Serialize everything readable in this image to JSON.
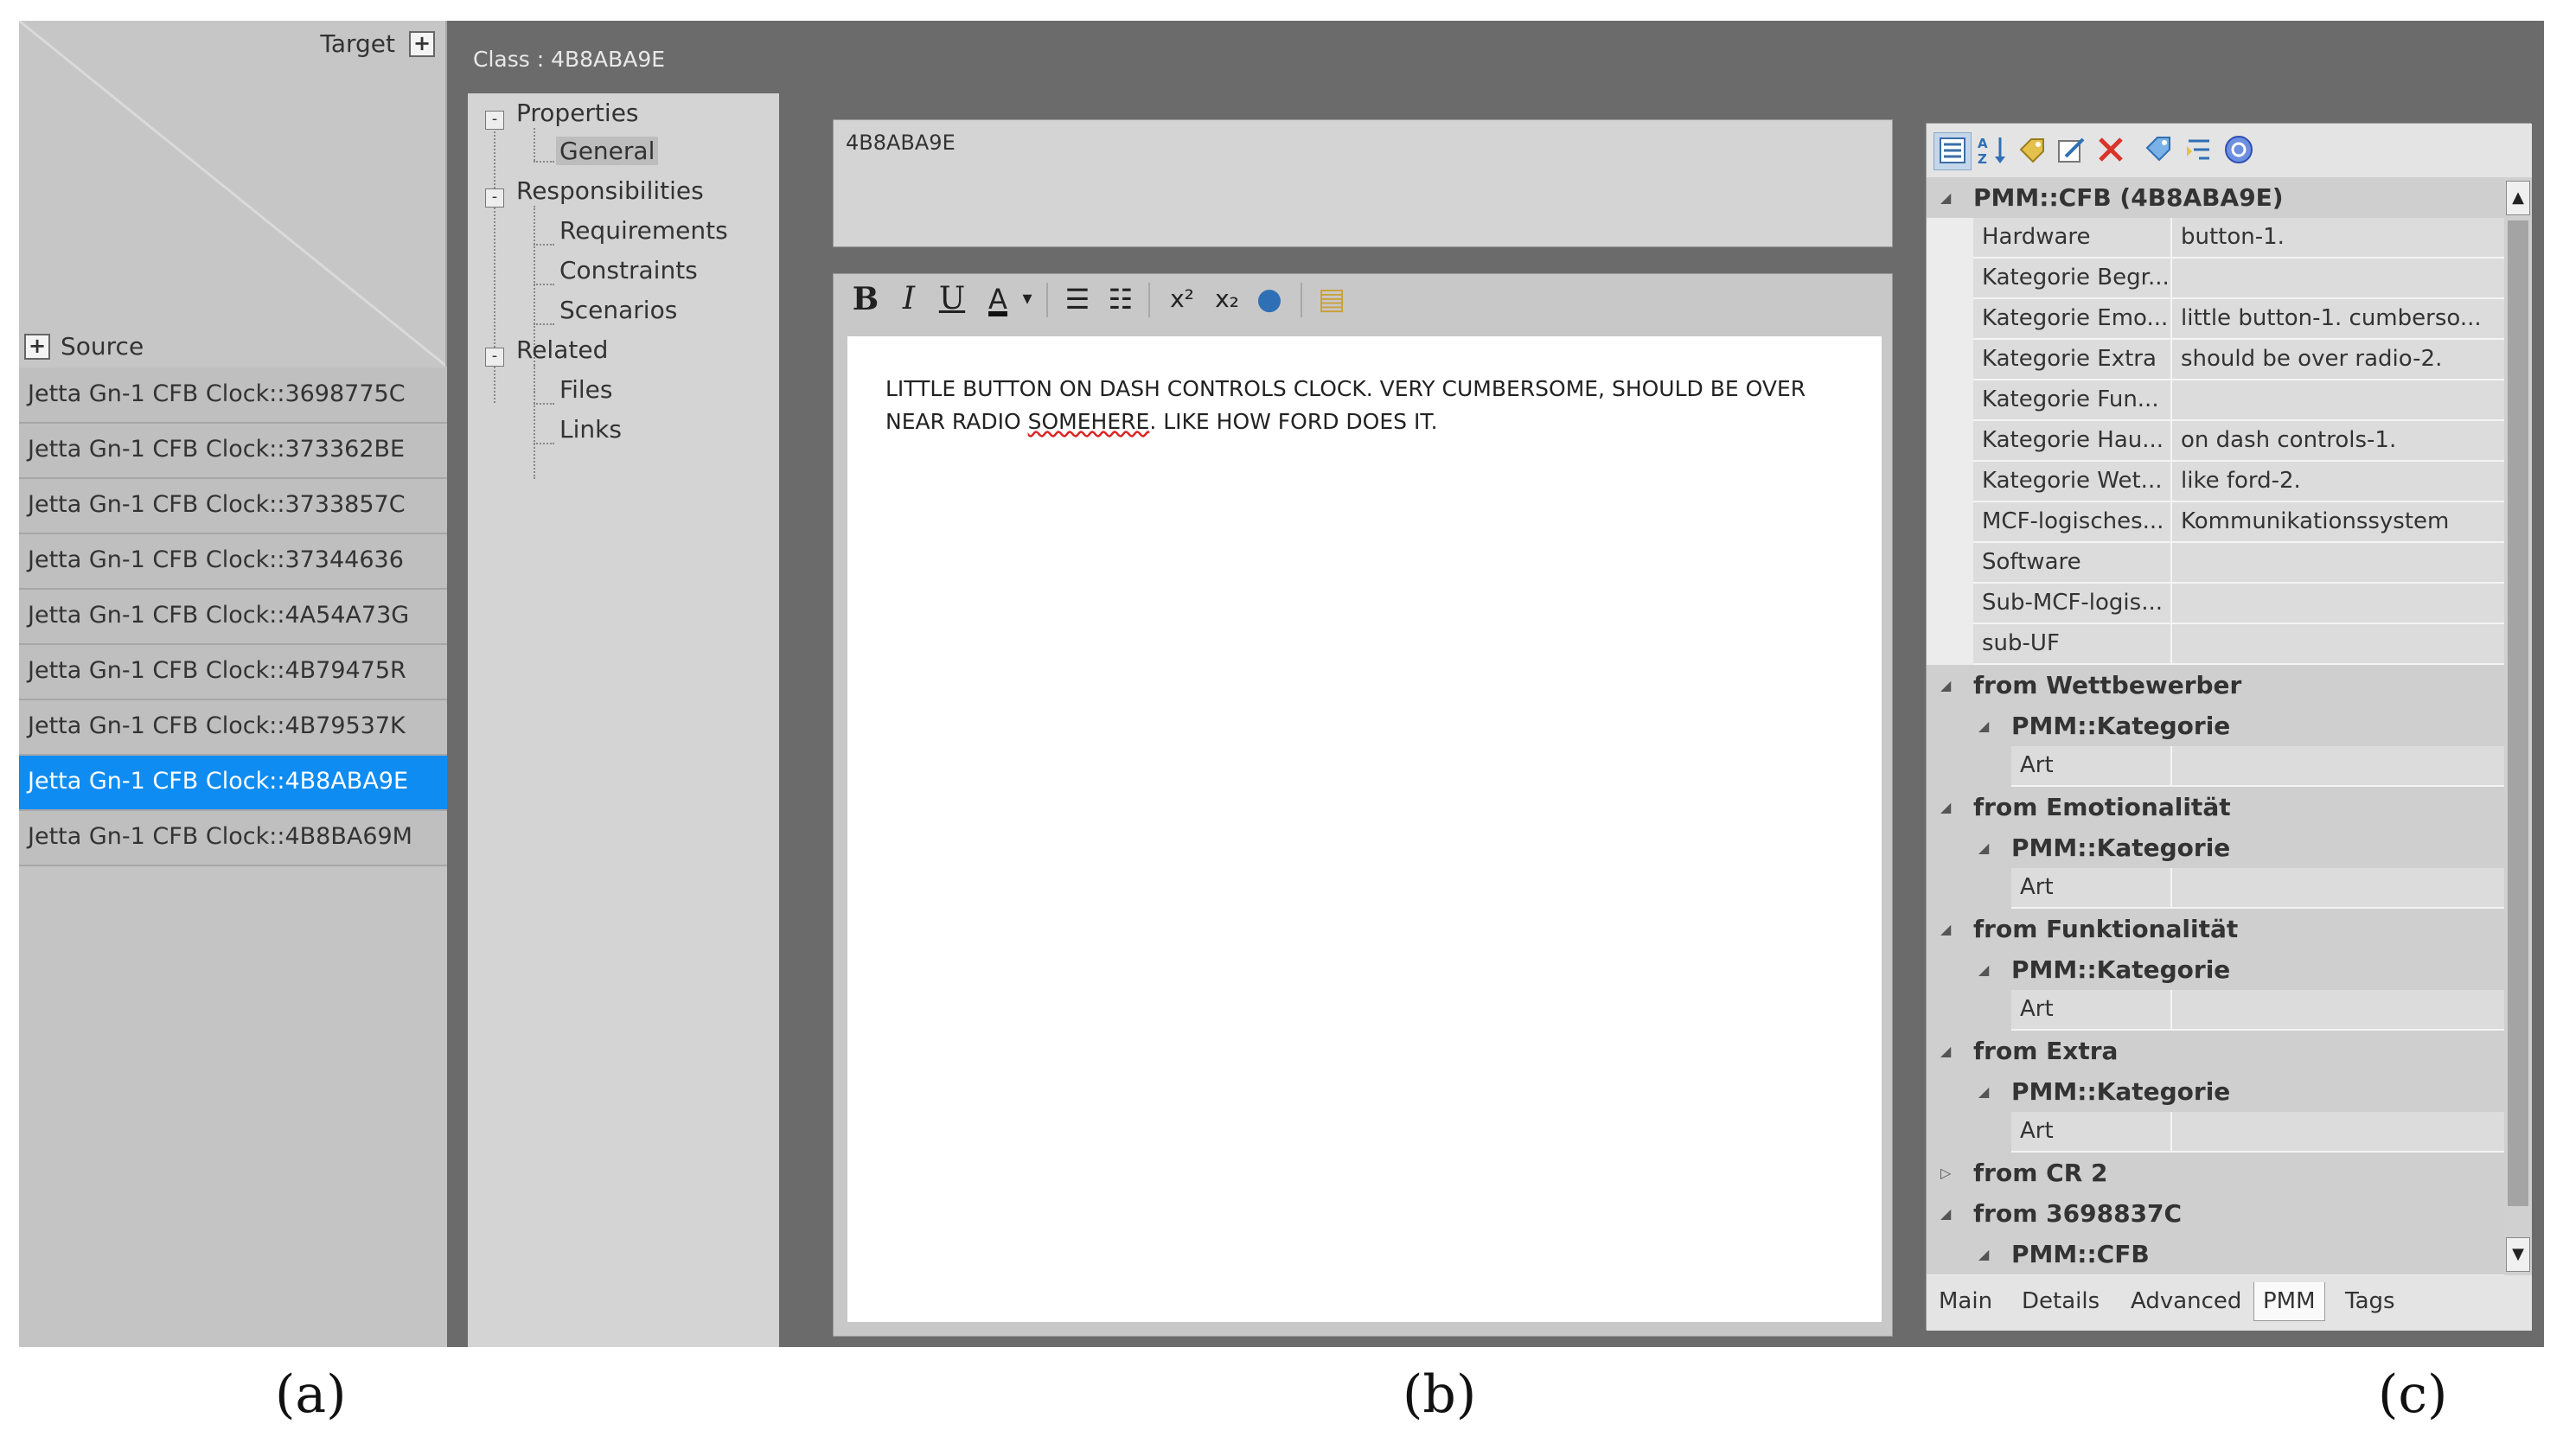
{
  "panel_a": {
    "target_label": "Target",
    "target_btn": "+",
    "source_btn": "+",
    "source_label": "Source",
    "rows": [
      "Jetta Gn-1 CFB Clock::3698775C",
      "Jetta Gn-1 CFB Clock::373362BE",
      "Jetta Gn-1 CFB Clock::3733857C",
      "Jetta Gn-1 CFB Clock::37344636",
      "Jetta Gn-1 CFB Clock::4A54A73G",
      "Jetta Gn-1 CFB Clock::4B79475R",
      "Jetta Gn-1 CFB Clock::4B79537K",
      "Jetta Gn-1 CFB Clock::4B8ABA9E",
      "Jetta Gn-1 CFB Clock::4B8BA69M"
    ],
    "selected_index": 7
  },
  "panel_b": {
    "class_title": "Class : 4B8ABA9E",
    "tree": {
      "properties": "Properties",
      "general": "General",
      "responsibilities": "Responsibilities",
      "requirements": "Requirements",
      "constraints": "Constraints",
      "scenarios": "Scenarios",
      "related": "Related",
      "files": "Files",
      "links": "Links",
      "toggle": "-"
    },
    "name_value": "4B8ABA9E",
    "toolbar": {
      "bold": "B",
      "italic": "I",
      "underline": "U",
      "color": "A",
      "dropdown": "▾",
      "bullets": "☰",
      "numbers": "☷",
      "superscript": "x²",
      "subscript": "x₂",
      "web": "●",
      "doc": "▤"
    },
    "text_line1": "LITTLE BUTTON ON DASH CONTROLS CLOCK. VERY CUMBERSOME, SHOULD BE OVER",
    "text_line2_a": "NEAR RADIO ",
    "text_line2_misspelled": "SOMEHERE",
    "text_line2_b": ". LIKE HOW FORD DOES IT."
  },
  "panel_c": {
    "icons": [
      "categorized-icon",
      "sort-az-icon",
      "tag-add-icon",
      "edit-icon",
      "delete-icon",
      "tag-icon",
      "filter-icon",
      "help-icon"
    ],
    "caret_open": "◢",
    "caret_closed": "▷",
    "root": "PMM::CFB (4B8ABA9E)",
    "props": [
      {
        "name": "Hardware",
        "value": "button-1."
      },
      {
        "name": "Kategorie Begr...",
        "value": ""
      },
      {
        "name": "Kategorie Emo...",
        "value": "little button-1. cumberso..."
      },
      {
        "name": "Kategorie Extra",
        "value": "should be over radio-2."
      },
      {
        "name": "Kategorie Fun...",
        "value": ""
      },
      {
        "name": "Kategorie Hau...",
        "value": "on dash controls-1."
      },
      {
        "name": "Kategorie Wet...",
        "value": "like ford-2."
      },
      {
        "name": "MCF-logisches...",
        "value": "Kommunikationssystem"
      },
      {
        "name": "Software",
        "value": ""
      },
      {
        "name": "Sub-MCF-logis...",
        "value": ""
      },
      {
        "name": "sub-UF",
        "value": ""
      }
    ],
    "groups": [
      {
        "label": "from Wettbewerber",
        "sub": "PMM::Kategorie",
        "prop": "Art"
      },
      {
        "label": "from Emotionalität",
        "sub": "PMM::Kategorie",
        "prop": "Art"
      },
      {
        "label": "from Funktionalität",
        "sub": "PMM::Kategorie",
        "prop": "Art"
      },
      {
        "label": "from Extra",
        "sub": "PMM::Kategorie",
        "prop": "Art"
      }
    ],
    "cr2": "from CR 2",
    "from_3698837c": "from 3698837C",
    "last_sub": "PMM::CFB",
    "scroll_up": "▲",
    "scroll_down": "▼",
    "tabs": [
      "Main",
      "Details",
      "Advanced",
      "PMM",
      "Tags"
    ],
    "active_tab": "PMM"
  },
  "captions": {
    "a": "(a)",
    "b": "(b)",
    "c": "(c)"
  },
  "colors": {
    "selection": "#0f8cf2",
    "frame": "#6b6b6b",
    "delete_red": "#d9332a",
    "icon_blue": "#2f6fb5"
  }
}
